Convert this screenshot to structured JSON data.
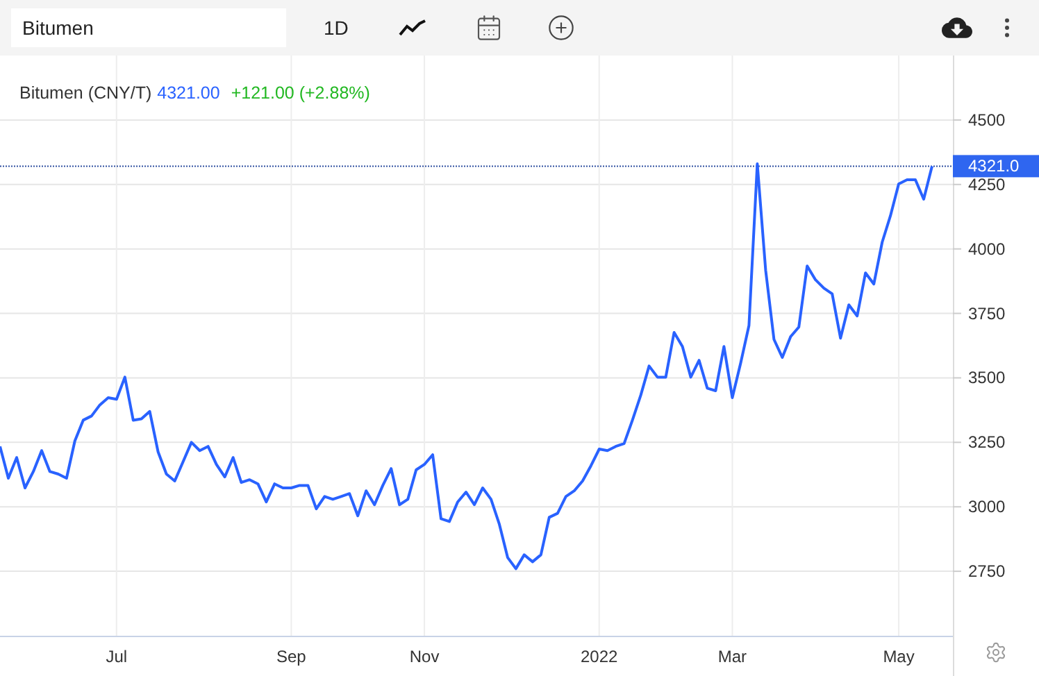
{
  "toolbar": {
    "search": {
      "value": "Bitumen"
    },
    "interval": "1D"
  },
  "legend": {
    "price": "4321.00",
    "change": "+121.00 (+2.88%)"
  },
  "price_tag": "4321.0",
  "chart": {
    "chart_data": {
      "type": "line",
      "grid": true,
      "ylim": [
        2500,
        4750
      ],
      "ref_lines": [
        {
          "axis": "y",
          "value": 4321
        }
      ],
      "categories": [
        null,
        null,
        null,
        null,
        null,
        null,
        null,
        null,
        null,
        null,
        null,
        null,
        null,
        null,
        "Jul",
        null,
        null,
        null,
        null,
        null,
        null,
        null,
        null,
        null,
        null,
        null,
        null,
        null,
        null,
        null,
        null,
        null,
        null,
        null,
        null,
        "Sep",
        null,
        null,
        null,
        null,
        null,
        null,
        null,
        null,
        null,
        null,
        null,
        null,
        null,
        null,
        null,
        "Nov",
        null,
        null,
        null,
        null,
        null,
        null,
        null,
        null,
        null,
        null,
        null,
        null,
        null,
        null,
        null,
        null,
        null,
        null,
        null,
        null,
        "2022",
        null,
        null,
        null,
        null,
        null,
        null,
        null,
        null,
        null,
        null,
        null,
        null,
        null,
        null,
        null,
        "Mar",
        null,
        null,
        null,
        null,
        null,
        null,
        null,
        null,
        null,
        null,
        null,
        null,
        null,
        null,
        null,
        null,
        null,
        null,
        null,
        "May",
        null,
        null,
        null,
        null
      ],
      "yticks": [
        2750,
        3000,
        3250,
        3500,
        3750,
        4000,
        4250,
        4500
      ],
      "series": [
        {
          "name": "Bitumen (CNY/T)",
          "color": "#2962ff",
          "values": [
            3234,
            3111,
            3191,
            3073,
            3137,
            3218,
            3137,
            3127,
            3111,
            3256,
            3336,
            3352,
            3395,
            3423,
            3417,
            3503,
            3336,
            3341,
            3370,
            3213,
            3127,
            3100,
            3175,
            3250,
            3218,
            3234,
            3164,
            3116,
            3191,
            3094,
            3105,
            3089,
            3019,
            3089,
            3073,
            3073,
            3083,
            3083,
            2992,
            3040,
            3029,
            3040,
            3051,
            2965,
            3062,
            3008,
            3083,
            3148,
            3008,
            3029,
            3143,
            3164,
            3202,
            2954,
            2943,
            3019,
            3057,
            3008,
            3073,
            3029,
            2932,
            2803,
            2760,
            2814,
            2787,
            2814,
            2959,
            2975,
            3040,
            3062,
            3100,
            3159,
            3224,
            3218,
            3234,
            3245,
            3336,
            3433,
            3546,
            3503,
            3503,
            3676,
            3622,
            3503,
            3568,
            3460,
            3450,
            3622,
            3423,
            3557,
            3703,
            4330,
            3918,
            3649,
            3579,
            3660,
            3697,
            3934,
            3880,
            3848,
            3826,
            3654,
            3783,
            3740,
            3907,
            3864,
            4026,
            4128,
            4252,
            4268,
            4268,
            4193,
            4321
          ]
        }
      ]
    }
  }
}
